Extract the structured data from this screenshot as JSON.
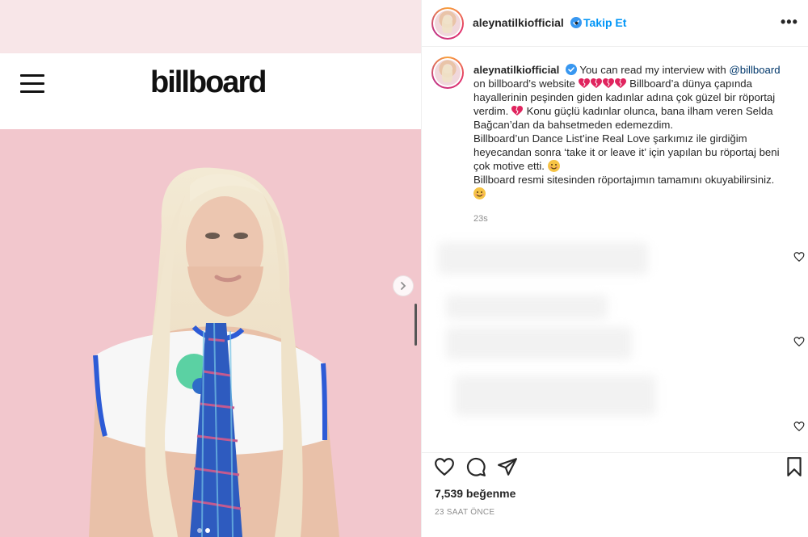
{
  "media": {
    "brand_logo": "billboard",
    "nav_icon": "hamburger-menu-icon",
    "next_icon": "chevron-right-icon",
    "carousel_dots": 2,
    "carousel_active_index": 1
  },
  "post": {
    "username": "aleynatilkiofficial",
    "verified": true,
    "separator": "•",
    "follow_label": "Takip Et",
    "more_label": "•••",
    "caption": {
      "intro": "You can read my interview with ",
      "mention": "@billboard",
      "line1": " on billboard’s website ",
      "line2": " Billboard’a dünya çapında hayallerinin peşinden giden kadınlar adına çok güzel bir röportaj verdim. ",
      "line3": " Konu güçlü kadınlar olunca, bana ilham veren Selda Bağcan’dan da bahsetmeden edemezdim.",
      "line4": "Billboard’un Dance List’ine Real Love şarkımız ile girdiğim heyecandan sonra ‘take it or leave it’ için yapılan bu röportaj beni çok motive etti. ",
      "line5": "Billboard resmi sitesinden röportajımın tamamını okuyabilirsiniz."
    },
    "time_ago": "23s",
    "likes": "7,539 beğenme",
    "date": "23 SAAT ÖNCE"
  },
  "colors": {
    "follow_blue": "#0095f6",
    "verified_blue": "#3897f0",
    "heart_red": "#e0245e",
    "photo_bg": "#f3c9cf"
  }
}
